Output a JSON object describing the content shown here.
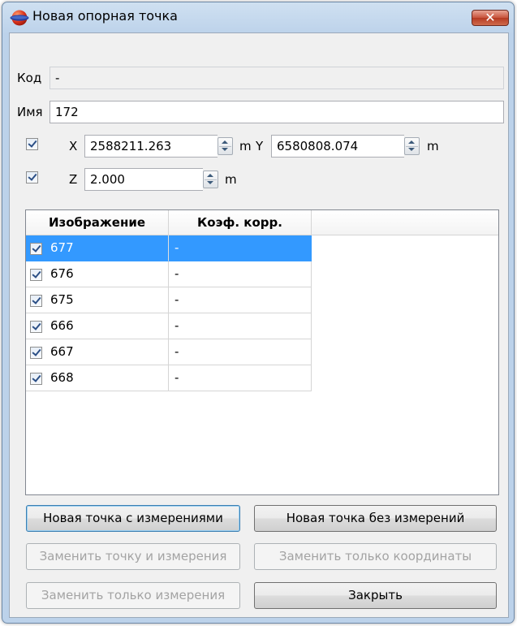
{
  "window": {
    "title": "Новая опорная точка",
    "close_glyph": "✕"
  },
  "code": {
    "label": "Код",
    "value": "-"
  },
  "name": {
    "label": "Имя",
    "value": "172"
  },
  "x": {
    "label": "X",
    "value": "2588211.263",
    "unit": "m"
  },
  "y": {
    "label": "Y",
    "value": "6580808.074",
    "unit": "m"
  },
  "z": {
    "label": "Z",
    "value": "2.000",
    "unit": "m"
  },
  "table": {
    "columns": [
      "Изображение",
      "Коэф. корр."
    ],
    "rows": [
      {
        "image": "677",
        "coef": "-",
        "checked": true,
        "selected": true
      },
      {
        "image": "676",
        "coef": "-",
        "checked": true,
        "selected": false
      },
      {
        "image": "675",
        "coef": "-",
        "checked": true,
        "selected": false
      },
      {
        "image": "666",
        "coef": "-",
        "checked": true,
        "selected": false
      },
      {
        "image": "667",
        "coef": "-",
        "checked": true,
        "selected": false
      },
      {
        "image": "668",
        "coef": "-",
        "checked": true,
        "selected": false
      }
    ]
  },
  "buttons": {
    "new_with": "Новая точка с измерениями",
    "new_without": "Новая точка без измерений",
    "replace_point": "Заменить точку и измерения",
    "replace_coords": "Заменить только координаты",
    "replace_meas": "Заменить только измерения",
    "close": "Закрыть"
  },
  "icons": {
    "app": "sphere-globe-icon",
    "close": "close-icon",
    "spin": "spin-updown-icon",
    "check": "checkbox-checked-icon"
  },
  "colors": {
    "selection": "#3399ff",
    "titlebar": "#bcd2ea",
    "close_button": "#c7533c"
  }
}
